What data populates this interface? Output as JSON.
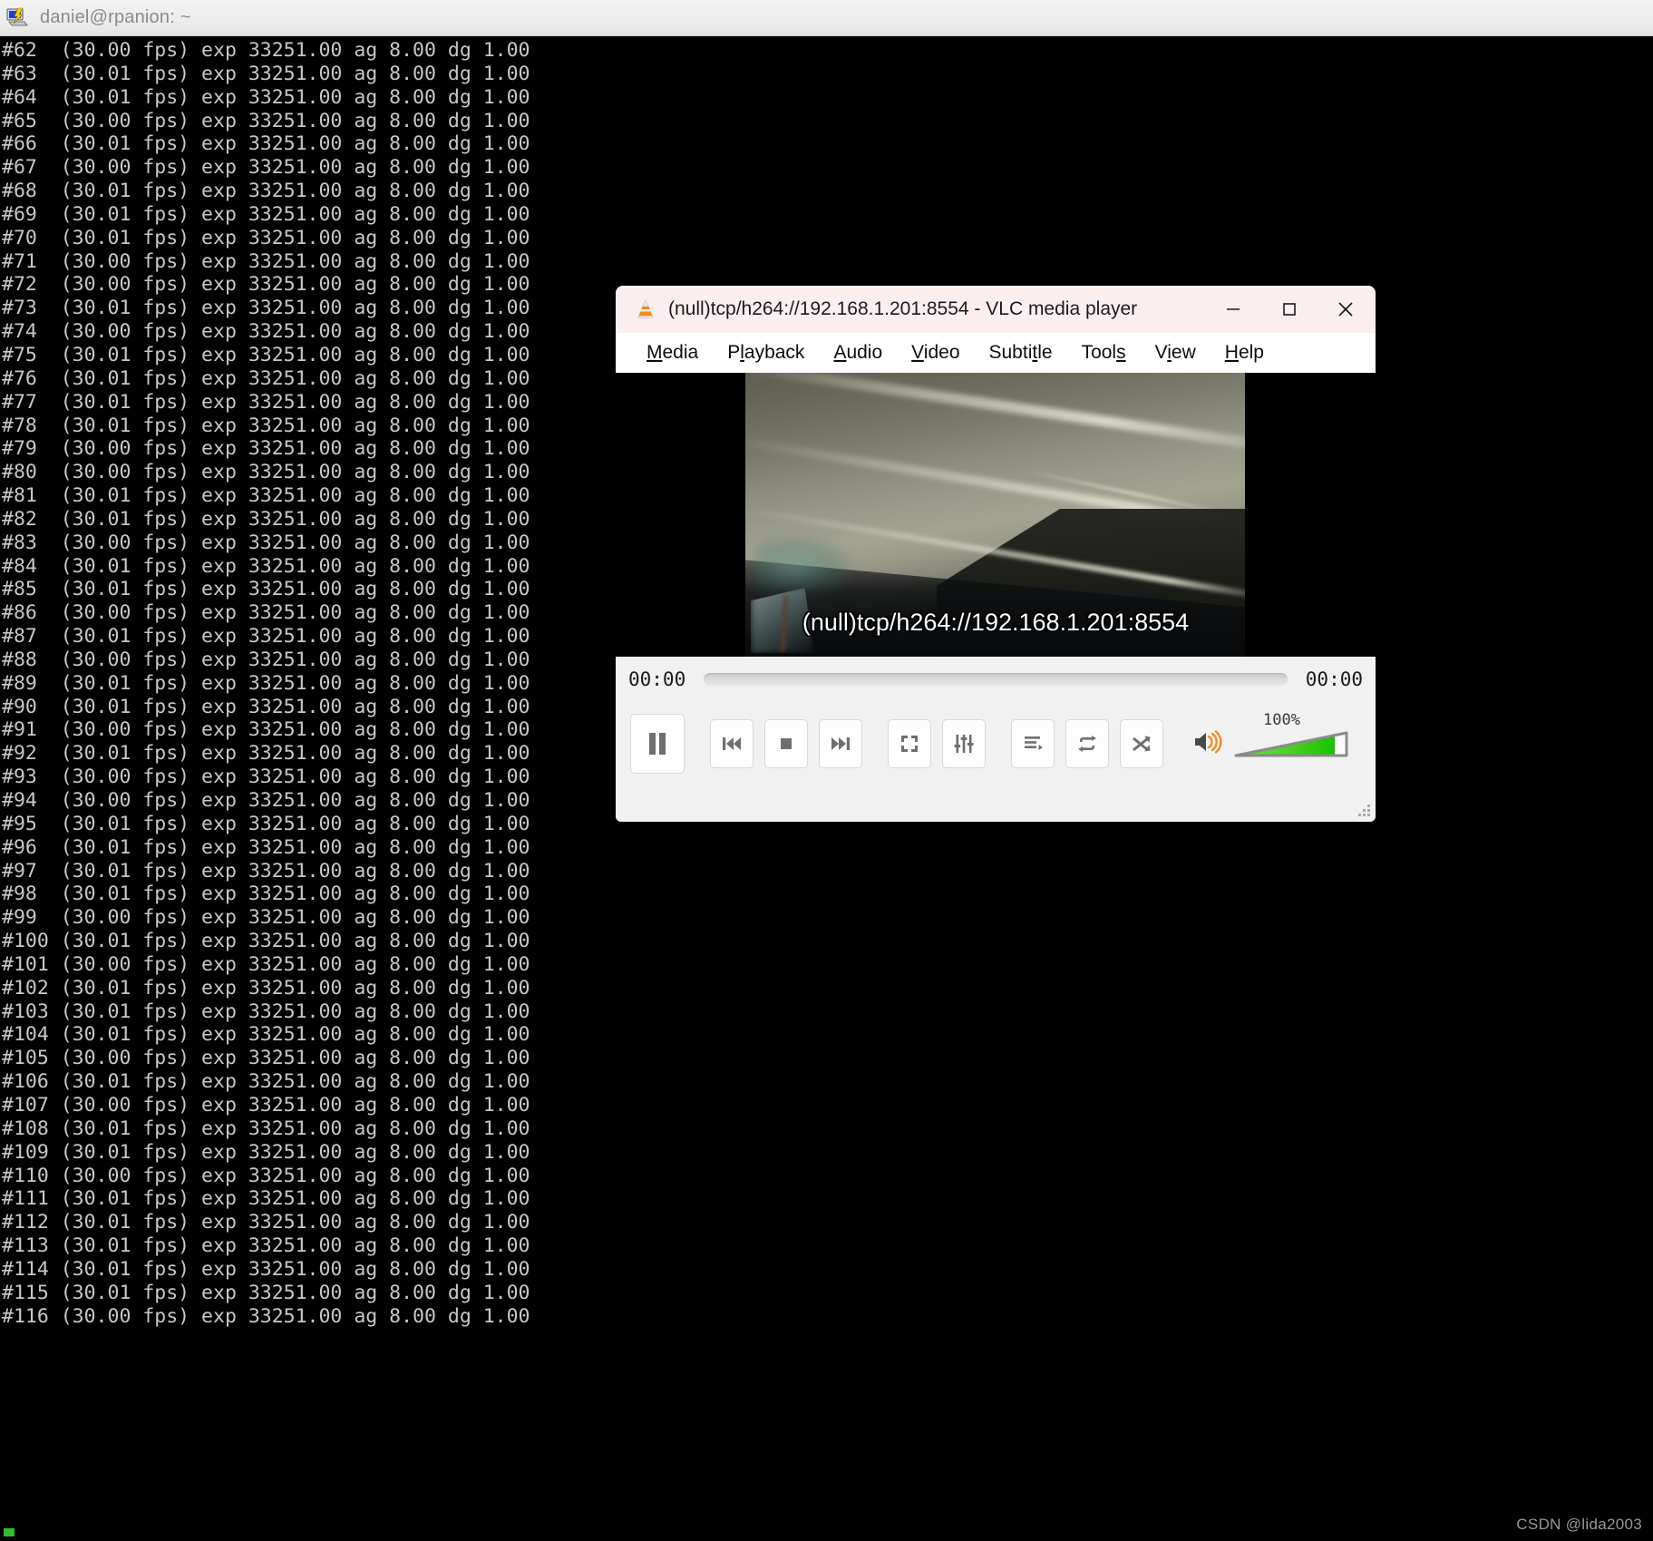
{
  "terminal": {
    "title": "daniel@rpanion: ~",
    "icon": "terminal-app-icon",
    "cursor_visible": true,
    "lines": [
      "#62  (30.00 fps) exp 33251.00 ag 8.00 dg 1.00",
      "#63  (30.01 fps) exp 33251.00 ag 8.00 dg 1.00",
      "#64  (30.01 fps) exp 33251.00 ag 8.00 dg 1.00",
      "#65  (30.00 fps) exp 33251.00 ag 8.00 dg 1.00",
      "#66  (30.01 fps) exp 33251.00 ag 8.00 dg 1.00",
      "#67  (30.00 fps) exp 33251.00 ag 8.00 dg 1.00",
      "#68  (30.01 fps) exp 33251.00 ag 8.00 dg 1.00",
      "#69  (30.01 fps) exp 33251.00 ag 8.00 dg 1.00",
      "#70  (30.01 fps) exp 33251.00 ag 8.00 dg 1.00",
      "#71  (30.00 fps) exp 33251.00 ag 8.00 dg 1.00",
      "#72  (30.00 fps) exp 33251.00 ag 8.00 dg 1.00",
      "#73  (30.01 fps) exp 33251.00 ag 8.00 dg 1.00",
      "#74  (30.00 fps) exp 33251.00 ag 8.00 dg 1.00",
      "#75  (30.01 fps) exp 33251.00 ag 8.00 dg 1.00",
      "#76  (30.01 fps) exp 33251.00 ag 8.00 dg 1.00",
      "#77  (30.01 fps) exp 33251.00 ag 8.00 dg 1.00",
      "#78  (30.01 fps) exp 33251.00 ag 8.00 dg 1.00",
      "#79  (30.00 fps) exp 33251.00 ag 8.00 dg 1.00",
      "#80  (30.00 fps) exp 33251.00 ag 8.00 dg 1.00",
      "#81  (30.01 fps) exp 33251.00 ag 8.00 dg 1.00",
      "#82  (30.01 fps) exp 33251.00 ag 8.00 dg 1.00",
      "#83  (30.00 fps) exp 33251.00 ag 8.00 dg 1.00",
      "#84  (30.01 fps) exp 33251.00 ag 8.00 dg 1.00",
      "#85  (30.01 fps) exp 33251.00 ag 8.00 dg 1.00",
      "#86  (30.00 fps) exp 33251.00 ag 8.00 dg 1.00",
      "#87  (30.01 fps) exp 33251.00 ag 8.00 dg 1.00",
      "#88  (30.00 fps) exp 33251.00 ag 8.00 dg 1.00",
      "#89  (30.01 fps) exp 33251.00 ag 8.00 dg 1.00",
      "#90  (30.01 fps) exp 33251.00 ag 8.00 dg 1.00",
      "#91  (30.00 fps) exp 33251.00 ag 8.00 dg 1.00",
      "#92  (30.01 fps) exp 33251.00 ag 8.00 dg 1.00",
      "#93  (30.00 fps) exp 33251.00 ag 8.00 dg 1.00",
      "#94  (30.00 fps) exp 33251.00 ag 8.00 dg 1.00",
      "#95  (30.01 fps) exp 33251.00 ag 8.00 dg 1.00",
      "#96  (30.01 fps) exp 33251.00 ag 8.00 dg 1.00",
      "#97  (30.01 fps) exp 33251.00 ag 8.00 dg 1.00",
      "#98  (30.01 fps) exp 33251.00 ag 8.00 dg 1.00",
      "#99  (30.00 fps) exp 33251.00 ag 8.00 dg 1.00",
      "#100 (30.01 fps) exp 33251.00 ag 8.00 dg 1.00",
      "#101 (30.00 fps) exp 33251.00 ag 8.00 dg 1.00",
      "#102 (30.01 fps) exp 33251.00 ag 8.00 dg 1.00",
      "#103 (30.01 fps) exp 33251.00 ag 8.00 dg 1.00",
      "#104 (30.01 fps) exp 33251.00 ag 8.00 dg 1.00",
      "#105 (30.00 fps) exp 33251.00 ag 8.00 dg 1.00",
      "#106 (30.01 fps) exp 33251.00 ag 8.00 dg 1.00",
      "#107 (30.00 fps) exp 33251.00 ag 8.00 dg 1.00",
      "#108 (30.01 fps) exp 33251.00 ag 8.00 dg 1.00",
      "#109 (30.01 fps) exp 33251.00 ag 8.00 dg 1.00",
      "#110 (30.00 fps) exp 33251.00 ag 8.00 dg 1.00",
      "#111 (30.01 fps) exp 33251.00 ag 8.00 dg 1.00",
      "#112 (30.01 fps) exp 33251.00 ag 8.00 dg 1.00",
      "#113 (30.01 fps) exp 33251.00 ag 8.00 dg 1.00",
      "#114 (30.01 fps) exp 33251.00 ag 8.00 dg 1.00",
      "#115 (30.01 fps) exp 33251.00 ag 8.00 dg 1.00",
      "#116 (30.00 fps) exp 33251.00 ag 8.00 dg 1.00"
    ]
  },
  "vlc": {
    "title": "(null)tcp/h264://192.168.1.201:8554 - VLC media player",
    "app_icon": "vlc-cone-icon",
    "window_buttons": [
      {
        "name": "minimize-button",
        "icon": "minimize-icon"
      },
      {
        "name": "maximize-button",
        "icon": "maximize-icon"
      },
      {
        "name": "close-button",
        "icon": "close-icon"
      }
    ],
    "menu": [
      {
        "label": "Media",
        "accel": "M",
        "pre": "",
        "post": "edia"
      },
      {
        "label": "Playback",
        "accel": "l",
        "pre": "P",
        "post": "ayback"
      },
      {
        "label": "Audio",
        "accel": "A",
        "pre": "",
        "post": "udio"
      },
      {
        "label": "Video",
        "accel": "V",
        "pre": "",
        "post": "ideo"
      },
      {
        "label": "Subtitle",
        "accel": "t",
        "pre": "Subti",
        "post": "le"
      },
      {
        "label": "Tools",
        "accel": "s",
        "pre": "Tool",
        "post": ""
      },
      {
        "label": "View",
        "accel": "i",
        "pre": "V",
        "post": "ew"
      },
      {
        "label": "Help",
        "accel": "H",
        "pre": "",
        "post": "elp"
      }
    ],
    "osd_text": "(null)tcp/h264://192.168.1.201:8554",
    "time_elapsed": "00:00",
    "time_total": "00:00",
    "seek_position_percent": 0,
    "volume_percent": "100%",
    "volume_level": 100,
    "volume_color": "#35c413",
    "controls": [
      {
        "name": "play-pause-button",
        "icon": "pause-icon",
        "size": "big"
      },
      {
        "name": "previous-button",
        "icon": "previous-icon",
        "size": "small"
      },
      {
        "name": "stop-button",
        "icon": "stop-icon",
        "size": "small"
      },
      {
        "name": "next-button",
        "icon": "next-icon",
        "size": "small"
      },
      {
        "name": "fullscreen-button",
        "icon": "fullscreen-icon",
        "size": "small"
      },
      {
        "name": "equalizer-button",
        "icon": "equalizer-icon",
        "size": "small"
      },
      {
        "name": "playlist-button",
        "icon": "playlist-icon",
        "size": "small"
      },
      {
        "name": "loop-button",
        "icon": "loop-icon",
        "size": "small"
      },
      {
        "name": "shuffle-button",
        "icon": "shuffle-icon",
        "size": "small"
      }
    ]
  },
  "watermark": "CSDN @lida2003"
}
